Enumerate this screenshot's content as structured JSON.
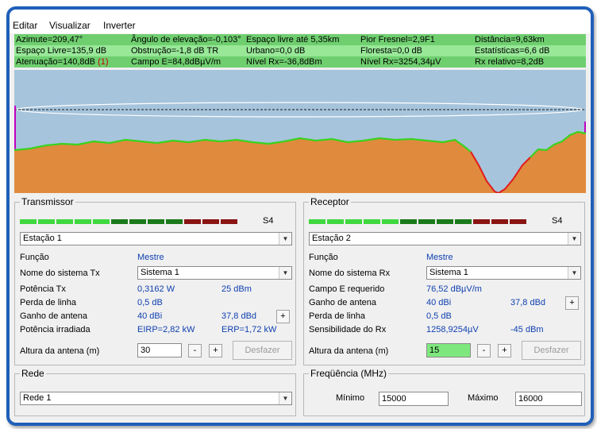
{
  "menu": {
    "items": [
      "Editar",
      "Visualizar",
      "Inverter"
    ]
  },
  "info": {
    "azimuth": "Azimute=209,47°",
    "elevation": "Ângulo de elevação=-0,103°",
    "free_space_up_to": "Espaço livre até 5,35km",
    "worst_fresnel": "Pior Fresnel=2,9F1",
    "distance": "Distância=9,63km",
    "free_space_loss": "Espaço Livre=135,9 dB",
    "obstruction": "Obstrução=-1,8 dB TR",
    "urban": "Urbano=0,0 dB",
    "forest": "Floresta=0,0 dB",
    "statistics": "Estatísticas=6,6 dB",
    "attenuation": "Atenuação=140,8dB",
    "attenuation_note": "(1)",
    "e_field": "Campo E=84,8dBµV/m",
    "rx_level_dbm": "Nível Rx=-36,8dBm",
    "rx_level_uv": "Nível Rx=3254,34µV",
    "rx_relative": "Rx relativo=8,2dB"
  },
  "colors": {
    "terrain": "#e08a3e",
    "sky": "#a6c4dc",
    "terrain_line": "#3ad21f",
    "obstructed_line": "#e11b1b",
    "info_green": "#6fcf6f",
    "accent": "#1f5fb8"
  },
  "transmitter": {
    "title": "Transmissor",
    "signal_label": "S4",
    "station": "Estação   1",
    "function_label": "Função",
    "function_value": "Mestre",
    "system_label": "Nome do sistema Tx",
    "system_value": "Sistema  1",
    "power_label": "Potência Tx",
    "power_w": "0,3162 W",
    "power_dbm": "25 dBm",
    "line_loss_label": "Perda de linha",
    "line_loss": "0,5 dB",
    "gain_label": "Ganho de antena",
    "gain_dbi": "40 dBi",
    "gain_dbd": "37,8 dBd",
    "plus": "+",
    "radiated_label": "Potência irradiada",
    "eirp": "EIRP=2,82 kW",
    "erp": "ERP=1,72 kW",
    "height_label": "Altura da antena (m)",
    "height": "30",
    "minus": "-",
    "undo": "Desfazer"
  },
  "receiver": {
    "title": "Receptor",
    "signal_label": "S4",
    "station": "Estação   2",
    "function_label": "Função",
    "function_value": "Mestre",
    "system_label": "Nome do sistema Rx",
    "system_value": "Sistema  1",
    "e_field_label": "Campo E requerido",
    "e_field": "76,52 dBµV/m",
    "gain_label": "Ganho de antena",
    "gain_dbi": "40 dBi",
    "gain_dbd": "37,8 dBd",
    "plus": "+",
    "line_loss_label": "Perda de linha",
    "line_loss": "0,5 dB",
    "sens_label": "Sensibilidade do Rx",
    "sens_uv": "1258,9254µV",
    "sens_dbm": "-45 dBm",
    "height_label": "Altura da antena (m)",
    "height": "15",
    "minus": "-",
    "undo": "Desfazer"
  },
  "network": {
    "title": "Rede",
    "value": "Rede  1"
  },
  "frequency": {
    "title": "Freqüência (MHz)",
    "min_label": "Mínimo",
    "min": "15000",
    "max_label": "Máximo",
    "max": "16000"
  }
}
